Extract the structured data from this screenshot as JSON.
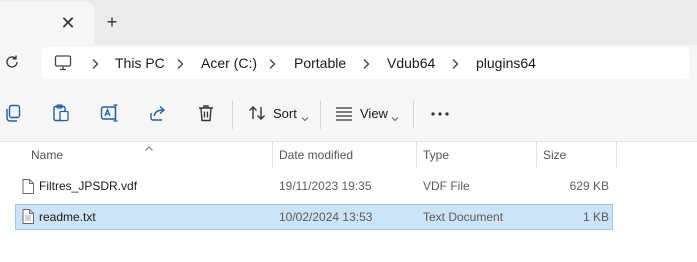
{
  "tabbar": {
    "close_glyph": "✕",
    "new_tab_glyph": "+"
  },
  "address": {
    "crumbs": [
      "This PC",
      "Acer (C:)",
      "Portable",
      "Vdub64",
      "plugins64"
    ]
  },
  "commandbar": {
    "sort_label": "Sort",
    "view_label": "View"
  },
  "columns": {
    "name": "Name",
    "date": "Date modified",
    "type": "Type",
    "size": "Size"
  },
  "files": [
    {
      "name": "Filtres_JPSDR.vdf",
      "date": "19/11/2023 19:35",
      "type": "VDF File",
      "size": "629 KB",
      "selected": false
    },
    {
      "name": "readme.txt",
      "date": "10/02/2024 13:53",
      "type": "Text Document",
      "size": "1 KB",
      "selected": true
    }
  ],
  "colors": {
    "selection_bg": "#cce4f7",
    "selection_border": "#99c9ef",
    "accent_icon": "#1f5fa8"
  }
}
